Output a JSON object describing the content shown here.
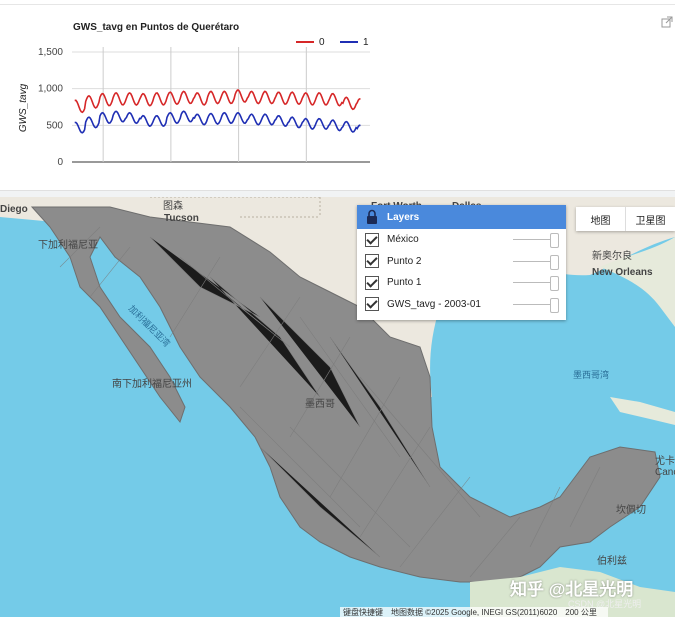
{
  "chart": {
    "title": "GWS_tavg en Puntos de Querétaro",
    "ylabel": "GWS_tavg",
    "legend": [
      {
        "name": "0",
        "color": "#d62728"
      },
      {
        "name": "1",
        "color": "#1f2fb4"
      }
    ],
    "y_ticks": [
      "0",
      "500",
      "1,000",
      "1,500"
    ]
  },
  "chart_data": {
    "type": "line",
    "title": "GWS_tavg en Puntos de Querétaro",
    "ylabel": "GWS_tavg",
    "xlabel": "",
    "ylim": [
      0,
      1500
    ],
    "x_range": [
      2003,
      2025
    ],
    "series": [
      {
        "name": "0",
        "color": "#d62728",
        "approx_mean": 900,
        "approx_amplitude": 150,
        "period_years": 1,
        "x": [
          2003,
          2004,
          2005,
          2006,
          2007,
          2008,
          2009,
          2010,
          2011,
          2012,
          2013,
          2014,
          2015,
          2016,
          2017,
          2018,
          2019,
          2020,
          2021,
          2022,
          2023,
          2024
        ],
        "values": [
          760,
          820,
          850,
          860,
          860,
          850,
          860,
          870,
          880,
          860,
          880,
          880,
          900,
          880,
          880,
          870,
          870,
          860,
          860,
          850,
          800,
          780
        ]
      },
      {
        "name": "1",
        "color": "#1f2fb4",
        "approx_mean": 560,
        "approx_amplitude": 130,
        "period_years": 1,
        "x": [
          2003,
          2004,
          2005,
          2006,
          2007,
          2008,
          2009,
          2010,
          2011,
          2012,
          2013,
          2014,
          2015,
          2016,
          2017,
          2018,
          2019,
          2020,
          2021,
          2022,
          2023,
          2024
        ],
        "values": [
          470,
          540,
          600,
          620,
          600,
          560,
          560,
          600,
          620,
          580,
          590,
          600,
          600,
          580,
          580,
          560,
          540,
          520,
          520,
          500,
          480,
          430
        ]
      }
    ]
  },
  "layers_panel": {
    "title": "Layers",
    "items": [
      {
        "label": "México",
        "checked": true
      },
      {
        "label": "Punto 2",
        "checked": true
      },
      {
        "label": "Punto 1",
        "checked": true
      },
      {
        "label": "GWS_tavg - 2003-01",
        "checked": true
      }
    ]
  },
  "map_type": {
    "map": "地图",
    "satellite": "卫星图"
  },
  "map_labels": {
    "diego": "Diego",
    "tucson_cn": "图森",
    "tucson": "Tucson",
    "fort_worth": "Fort Worth",
    "dallas": "Dallas",
    "new_orleans_cn": "新奥尔良",
    "new_orleans": "New Orleans",
    "baja": "下加利福尼亚",
    "gulf_ca": "加利福尼亚湾",
    "bcs": "南下加利福尼亚州",
    "mexico": "墨西哥",
    "gulf_mx": "墨西哥湾",
    "yucatan": "尤卡坦",
    "belize": "伯利兹",
    "campeche": "坎佩切",
    "cancun": "Cancún"
  },
  "attribution": {
    "shortcuts": "键盘快捷键",
    "data": "地图数据 ©2025 Google, INEGI GS(2011)6020",
    "scale": "200 公里"
  },
  "watermark": "知乎 @北星光明",
  "watermark2": "CSDN @北星光明"
}
